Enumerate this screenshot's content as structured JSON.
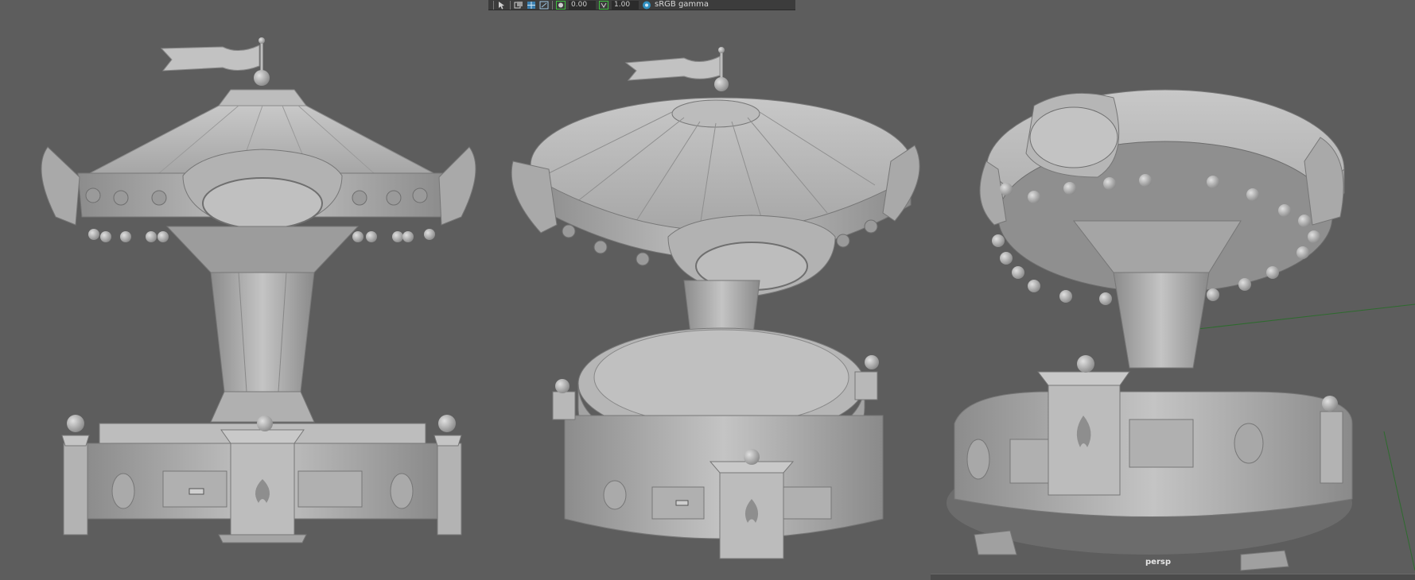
{
  "toolbar": {
    "exposure_value": "0.00",
    "gamma_value": "1.00",
    "color_space": "sRGB gamma",
    "icons": [
      "select-tool-icon",
      "camera-icon",
      "grid-icon",
      "exposure-toggle-icon",
      "gamma-toggle-icon",
      "color-space-icon"
    ]
  },
  "viewport": {
    "camera_label": "persp"
  },
  "colors": {
    "background": "#5d5d5d",
    "model_light": "#b9b9b9",
    "model_mid": "#9a9a9a",
    "model_dark": "#7e7e7e",
    "toolbar_bg": "#3c3c3c",
    "toggle_accent": "#3fbf3f"
  }
}
